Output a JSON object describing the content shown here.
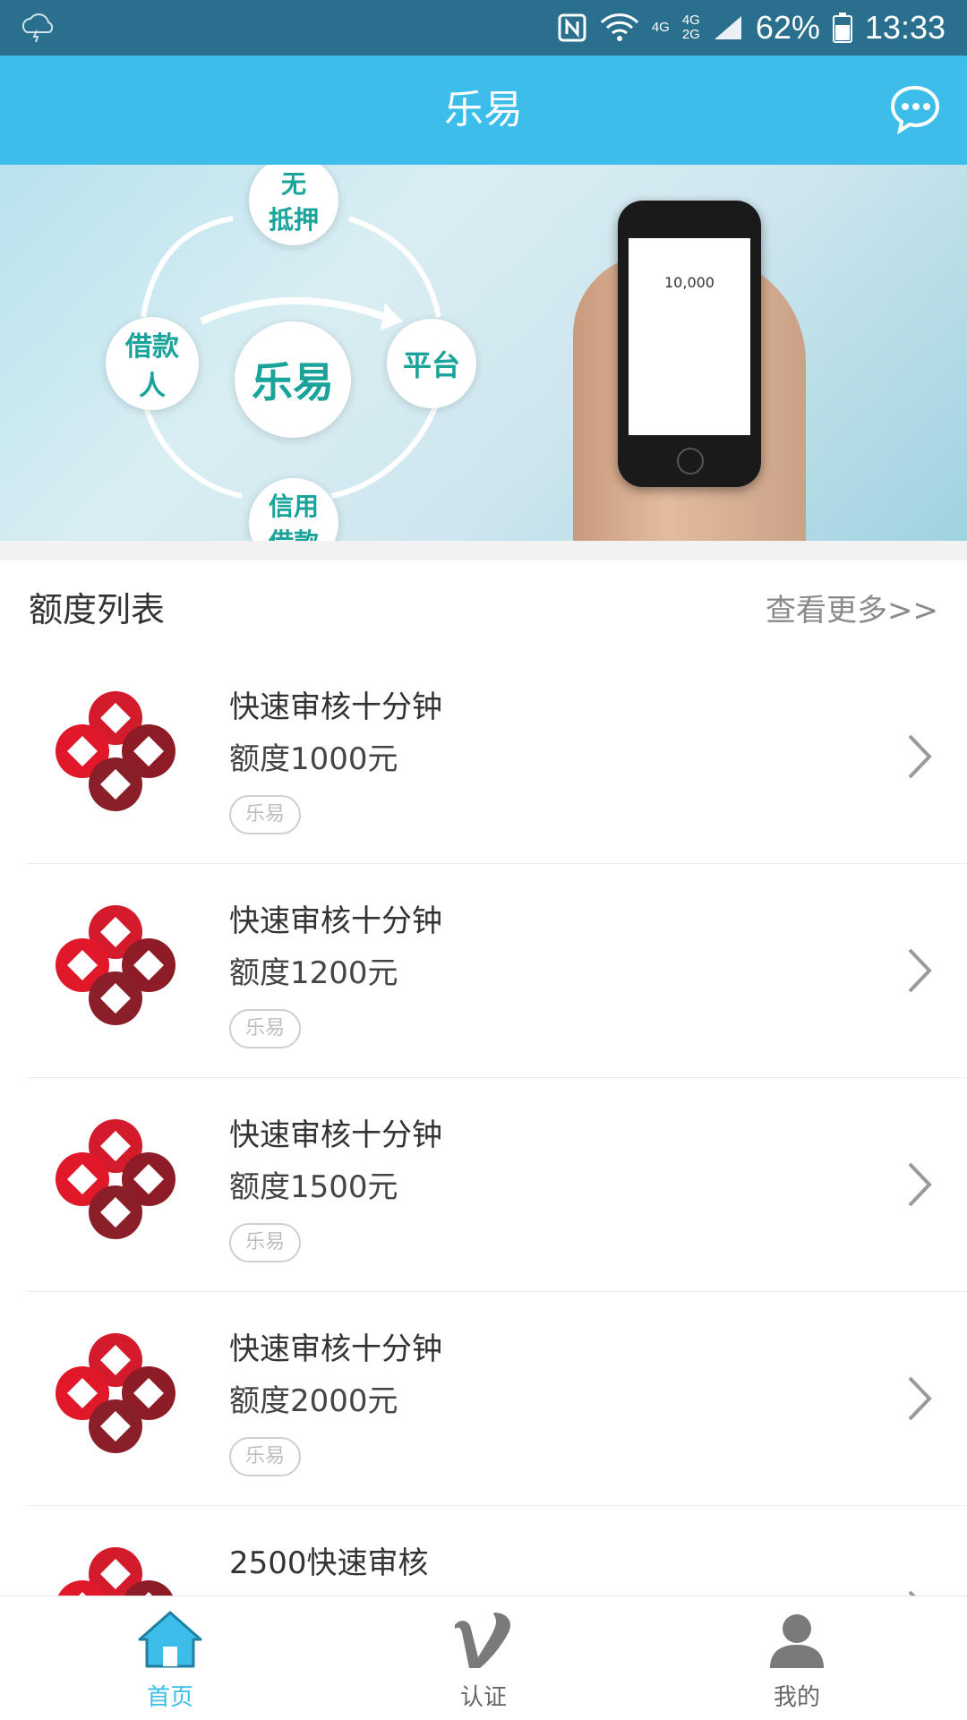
{
  "status_bar": {
    "network_top": "4G",
    "network_dual": "4G",
    "network_dual2": "2G",
    "battery": "62%",
    "time": "13:33"
  },
  "header": {
    "title": "乐易",
    "icon": "message-icon"
  },
  "banner": {
    "center": "乐易",
    "top_node": [
      "无",
      "抵押"
    ],
    "left_node": [
      "借款",
      "人"
    ],
    "right_node": "平台",
    "bottom_node": [
      "信用",
      "借款"
    ],
    "phone_amount": "10,000"
  },
  "section": {
    "title": "额度列表",
    "more": "查看更多>>"
  },
  "items": [
    {
      "name": "快速审核十分钟",
      "quota": "额度1000元",
      "tag": "乐易"
    },
    {
      "name": "快速审核十分钟",
      "quota": "额度1200元",
      "tag": "乐易"
    },
    {
      "name": "快速审核十分钟",
      "quota": "额度1500元",
      "tag": "乐易"
    },
    {
      "name": "快速审核十分钟",
      "quota": "额度2000元",
      "tag": "乐易"
    },
    {
      "name": "2500快速审核",
      "quota": "",
      "tag": ""
    }
  ],
  "tabs": [
    {
      "label": "首页",
      "icon": "home-icon",
      "active": true
    },
    {
      "label": "认证",
      "icon": "verify-v-icon",
      "active": false
    },
    {
      "label": "我的",
      "icon": "user-icon",
      "active": false
    }
  ],
  "colors": {
    "status": "#2a6f8e",
    "header": "#3cbdea",
    "active_tab": "#3cbdea",
    "inactive_tab": "#666666"
  }
}
